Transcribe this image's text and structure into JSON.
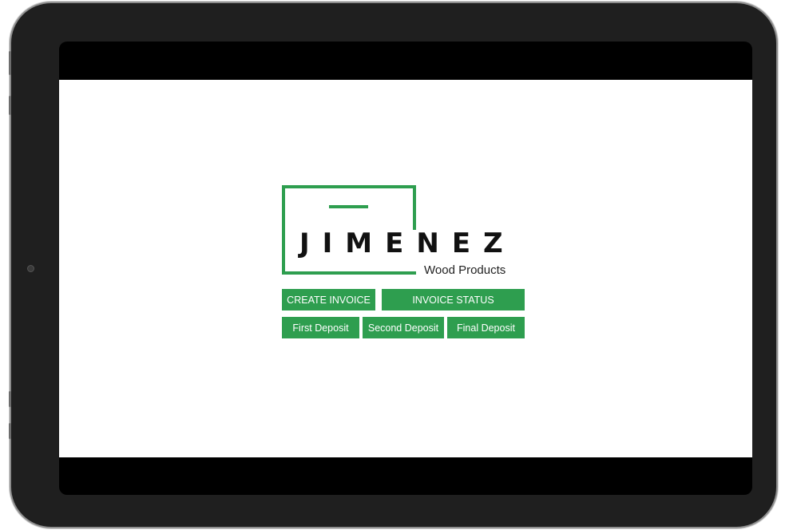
{
  "theme": {
    "accent": "#2e9e4f",
    "device_bezel": "#1f1f1f",
    "screen_bg": "#ffffff"
  },
  "logo": {
    "name": "JIMENEZ",
    "tagline": "Wood Products"
  },
  "actions": {
    "create_invoice": "CREATE INVOICE",
    "invoice_status": "INVOICE STATUS",
    "first_deposit": "First Deposit",
    "second_deposit": "Second Deposit",
    "final_deposit": "Final Deposit"
  }
}
